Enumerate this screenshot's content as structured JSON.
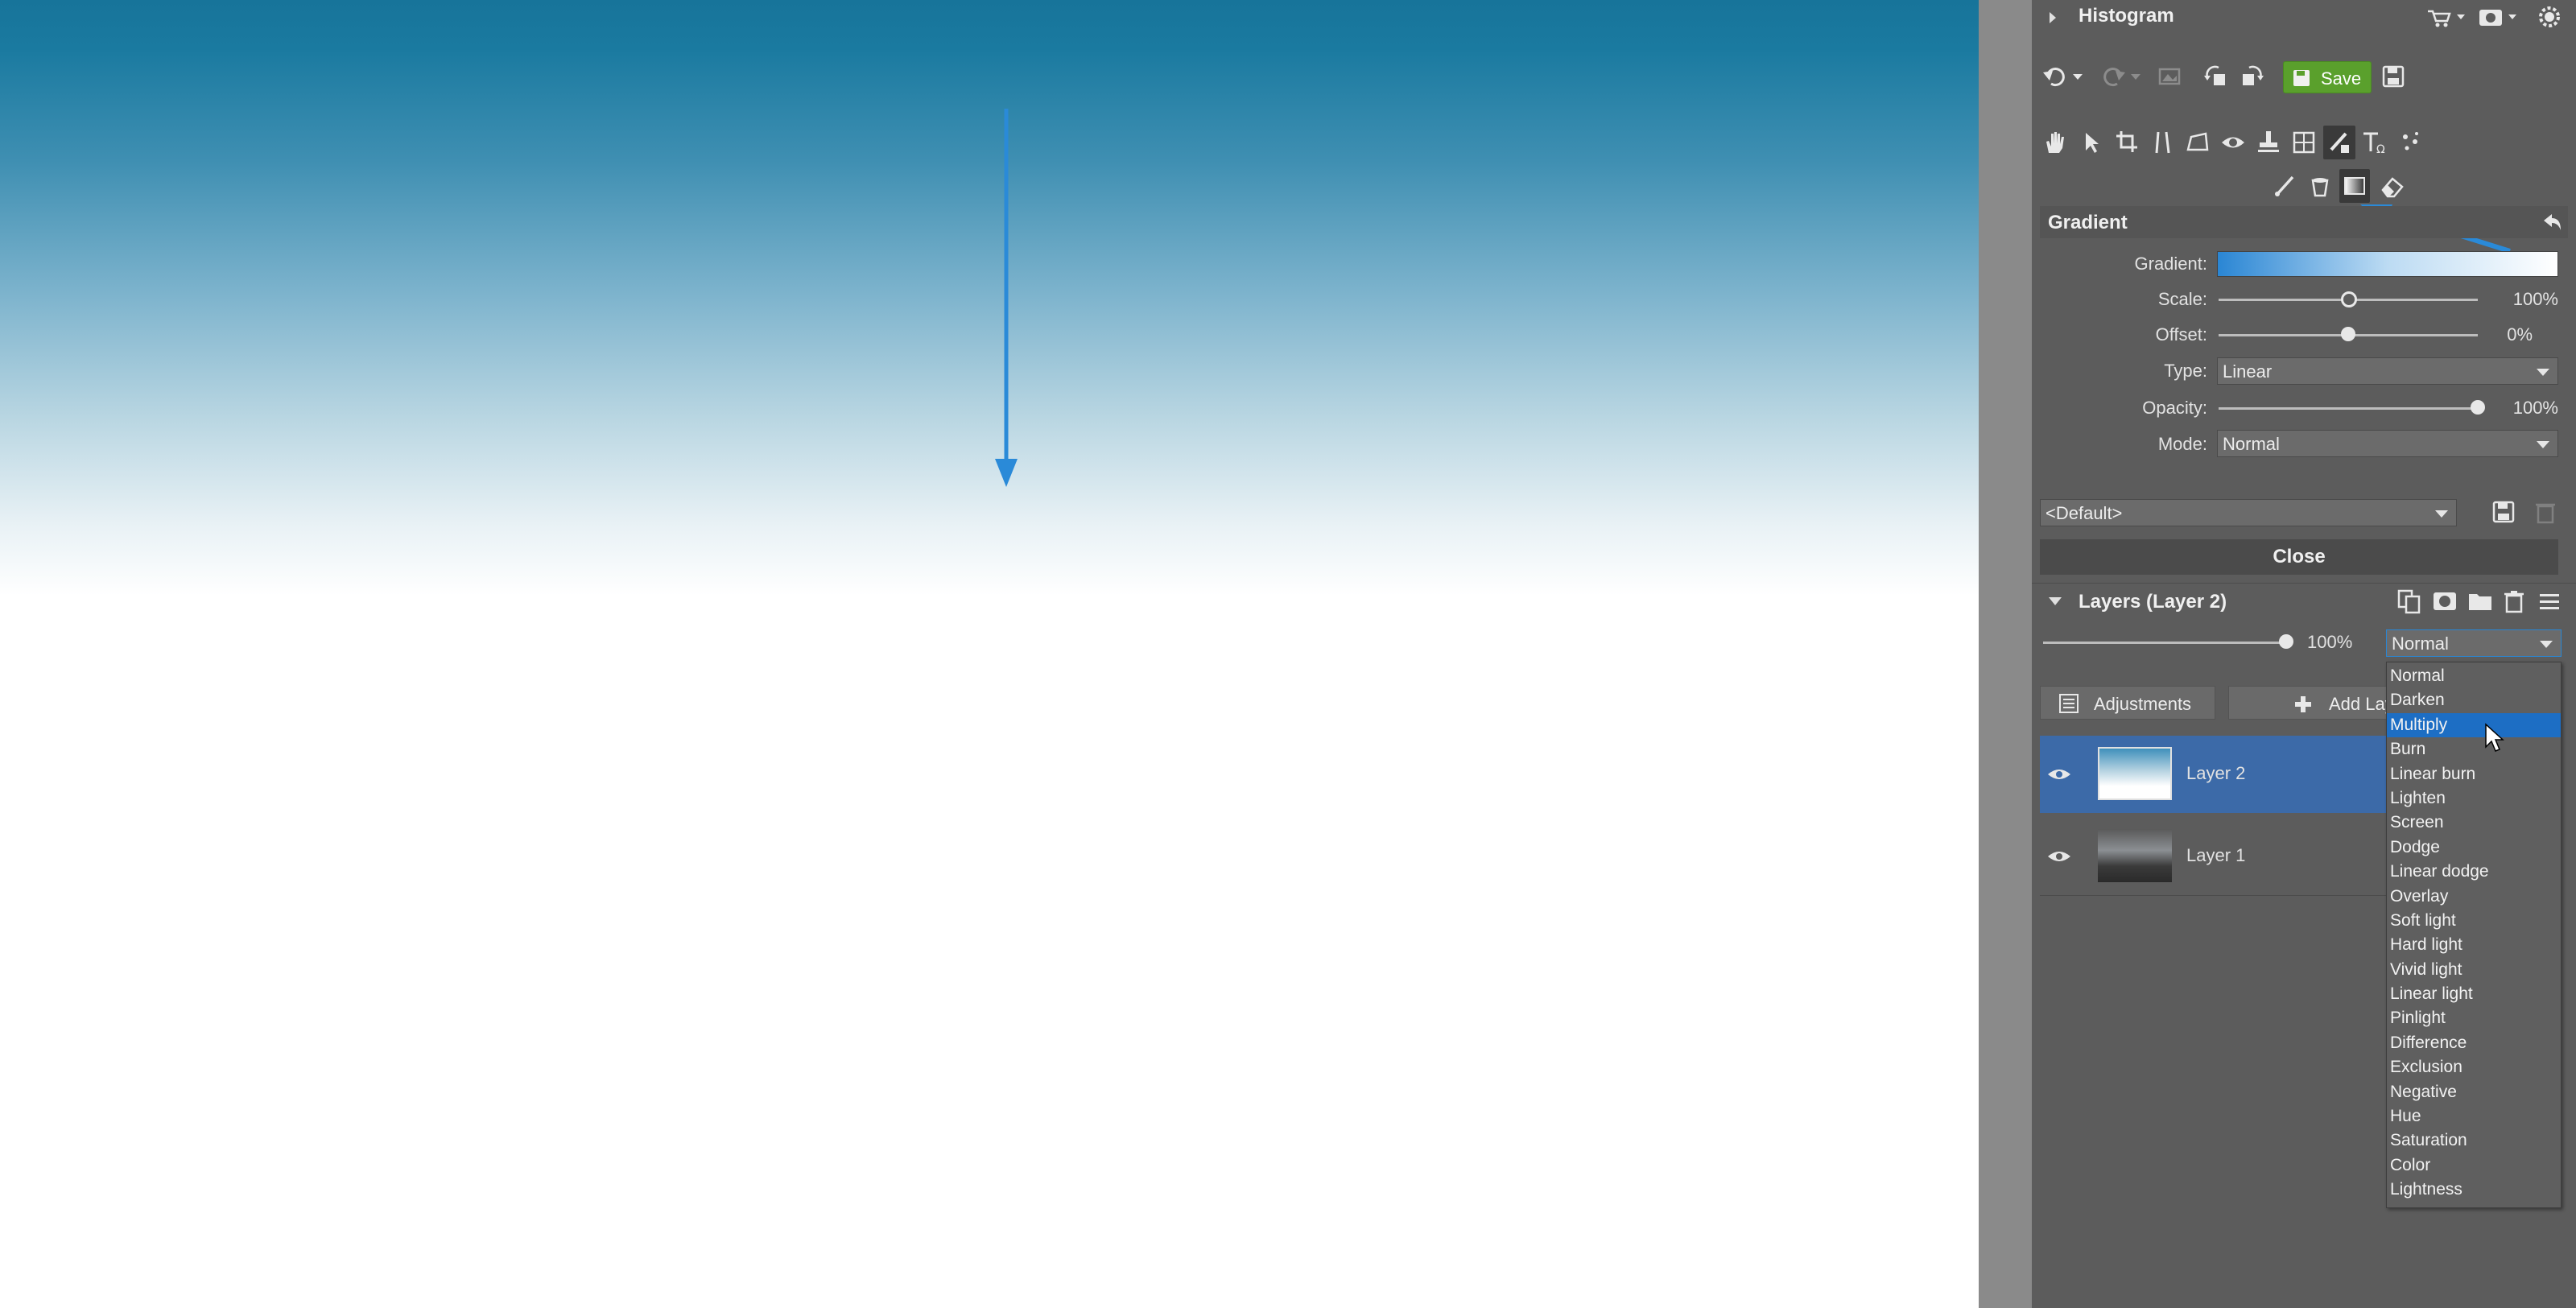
{
  "panels": {
    "histogram_title": "Histogram",
    "save_label": "Save",
    "gradient": {
      "title": "Gradient",
      "gradient_label": "Gradient:",
      "scale_label": "Scale:",
      "scale_value": "100%",
      "scale_level": 0.5,
      "offset_label": "Offset:",
      "offset_value": "0%",
      "offset_level": 0.5,
      "type_label": "Type:",
      "type_value": "Linear",
      "opacity_label": "Opacity:",
      "opacity_value": "100%",
      "opacity_level": 1.0,
      "mode_label": "Mode:",
      "mode_value": "Normal",
      "preset_value": "<Default>",
      "close_label": "Close"
    },
    "layers": {
      "title": "Layers (Layer 2)",
      "opacity_value": "100%",
      "opacity_level": 1.0,
      "blend_mode": "Normal",
      "adjustments_label": "Adjustments",
      "add_layer_label": "Add Lay",
      "items": [
        {
          "name": "Layer 2",
          "selected": true
        },
        {
          "name": "Layer 1",
          "selected": false
        }
      ]
    }
  },
  "blend_dropdown": {
    "options": [
      "Normal",
      "Darken",
      "Multiply",
      "Burn",
      "Linear burn",
      "Lighten",
      "Screen",
      "Dodge",
      "Linear dodge",
      "Overlay",
      "Soft light",
      "Hard light",
      "Vivid light",
      "Linear light",
      "Pinlight",
      "Difference",
      "Exclusion",
      "Negative",
      "Hue",
      "Saturation",
      "Color",
      "Lightness"
    ],
    "highlighted": "Multiply"
  },
  "colors": {
    "accent_blue": "#1d6ec4",
    "save_green": "#5aa02c",
    "selected_layer": "#3c6aa8",
    "arrow_blue": "#2a8ad8"
  },
  "icons": [
    "undo-icon",
    "redo-icon",
    "rotate-left-icon",
    "rotate-right-icon",
    "hand-icon",
    "select-icon",
    "crop-icon",
    "perspective-icon",
    "eye-icon",
    "brush-icon",
    "text-icon",
    "gradient-icon",
    "eraser-icon",
    "bucket-icon",
    "visibility-eye-icon"
  ]
}
